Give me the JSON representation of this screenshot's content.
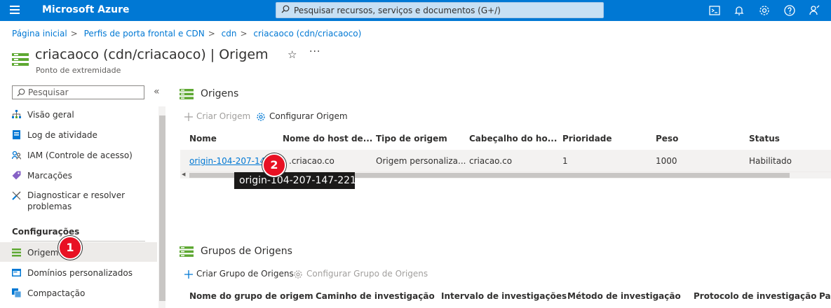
{
  "topbar": {
    "brand": "Microsoft Azure",
    "search_placeholder": "Pesquisar recursos, serviços e documentos (G+/)",
    "icons": [
      "menu-icon",
      "cloud-shell-icon",
      "bell-icon",
      "gear-icon",
      "help-icon",
      "feedback-icon"
    ],
    "color": "#0078d4"
  },
  "breadcrumb": [
    "Página inicial",
    "Perfis de porta frontal e CDN",
    "cdn",
    "criacaoco (cdn/criacaoco)"
  ],
  "header": {
    "title": "criacaoco (cdn/criacaoco) | Origem",
    "subtitle": "Ponto de extremidade",
    "more": "···"
  },
  "sidebar": {
    "search_placeholder": "Pesquisar",
    "collapse": "«",
    "items": [
      {
        "label": "Visão geral",
        "icon": "overview-icon"
      },
      {
        "label": "Log de atividade",
        "icon": "activity-log-icon"
      },
      {
        "label": "IAM (Controle de acesso)",
        "icon": "iam-icon"
      },
      {
        "label": "Marcações",
        "icon": "tag-icon"
      },
      {
        "label": "Diagnosticar e resolver",
        "label2": "problemas",
        "icon": "wrench-icon"
      }
    ],
    "section": "Configurações",
    "config_items": [
      {
        "label": "Origem",
        "icon": "origin-icon"
      },
      {
        "label": "Domínios personalizados",
        "icon": "domains-icon"
      },
      {
        "label": "Compactação",
        "icon": "compression-icon"
      }
    ]
  },
  "badges": {
    "one": "1",
    "two": "2",
    "color": "#e81123"
  },
  "origins": {
    "title": "Origens",
    "toolbar": {
      "create": "Criar Origem",
      "configure": "Configurar Origem"
    },
    "columns": [
      "Nome",
      "Nome do host de...",
      "Tipo de origem",
      "Cabeçalho do ho...",
      "Prioridade",
      "Peso",
      "Status"
    ],
    "row": {
      "name": "origin-104-207-147",
      "host": ".criacao.co",
      "type": "Origem personaliza...",
      "header": "criacao.co",
      "priority": "1",
      "weight": "1000",
      "status": "Habilitado"
    },
    "tooltip": "origin-104-207-147-221"
  },
  "groups": {
    "title": "Grupos de Origens",
    "toolbar": {
      "create": "Criar Grupo de Origens",
      "configure": "Configurar Grupo de Origens"
    },
    "columns": [
      "Nome do grupo de origem",
      "Caminho de investigação",
      "Intervalo de investigações",
      "Método de investigação",
      "Protocolo de investigação",
      "Pad"
    ]
  }
}
